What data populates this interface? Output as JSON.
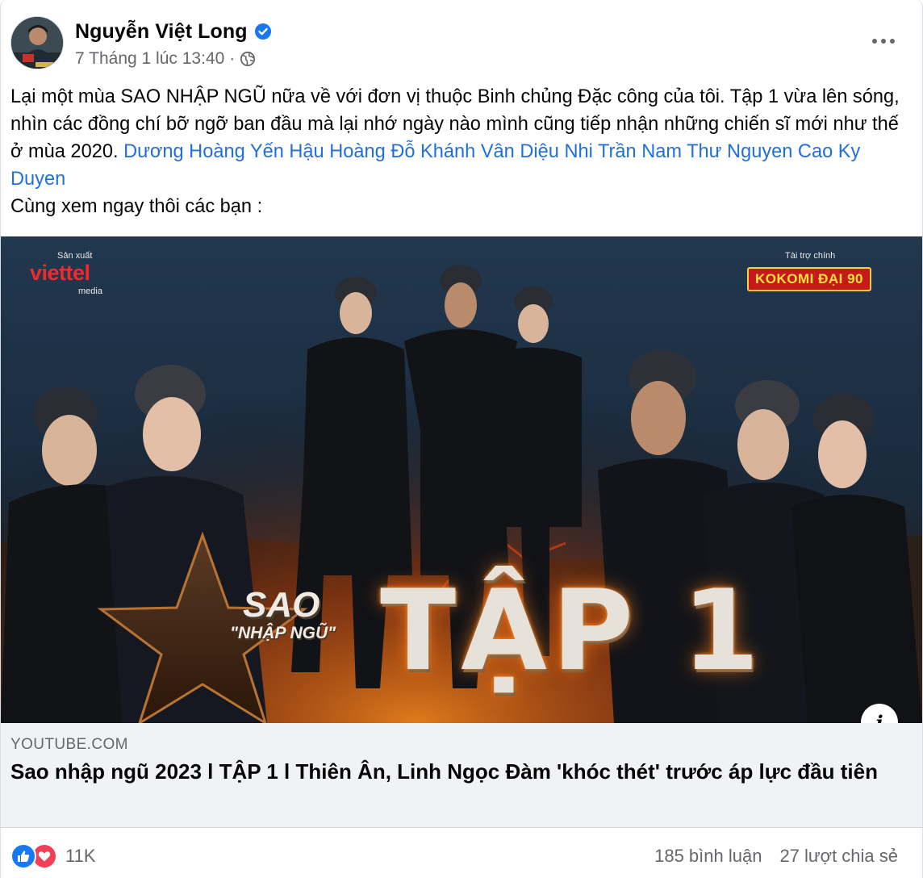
{
  "post": {
    "author": "Nguyễn Việt Long",
    "timestamp": "7 Tháng 1 lúc 13:40",
    "separator": "·",
    "audience_icon": "globe-icon",
    "verified_icon": "verified-badge-icon",
    "more_icon": "more-options-icon",
    "text_part1": "Lại một mùa SAO NHẬP NGŨ nữa về với đơn vị thuộc Binh chủng Đặc công của tôi. Tập 1 vừa  lên sóng,  nhìn các đồng chí bỡ ngỡ ban đầu mà lại nhớ ngày nào mình cũng tiếp nhận những chiến sĩ mới như thế ở mùa 2020. ",
    "mentions": [
      "Dương Hoàng Yến",
      "Hậu Hoàng",
      "Đỗ Khánh Vân",
      "Diệu Nhi",
      "Trần Nam Thư",
      "Nguyen Cao Ky Duyen"
    ],
    "text_part2": "Cùng xem ngay thôi các bạn :"
  },
  "media": {
    "producer_label": "Sản xuất",
    "producer_brand": "viettel",
    "producer_sub": "media",
    "sponsor_label": "Tài trợ chính",
    "sponsor_brand": "KOKOMI ĐẠI 90",
    "show_title_1": "SAO",
    "show_title_2": "\"NHẬP NGŨ\"",
    "episode": "TẬP 1",
    "info_icon": "i"
  },
  "link": {
    "domain": "YOUTUBE.COM",
    "title": "Sao nhập ngũ 2023 l TẬP 1 l Thiên Ân, Linh Ngọc Đàm 'khóc thét' trước áp lực đầu tiên"
  },
  "footer": {
    "reaction_count": "11K",
    "comments": "185 bình luận",
    "shares": "27 lượt chia sẻ"
  },
  "colors": {
    "link_blue": "#216fdb",
    "like_blue": "#1877f2",
    "love_red": "#f33e58",
    "meta_gray": "#65676b"
  }
}
